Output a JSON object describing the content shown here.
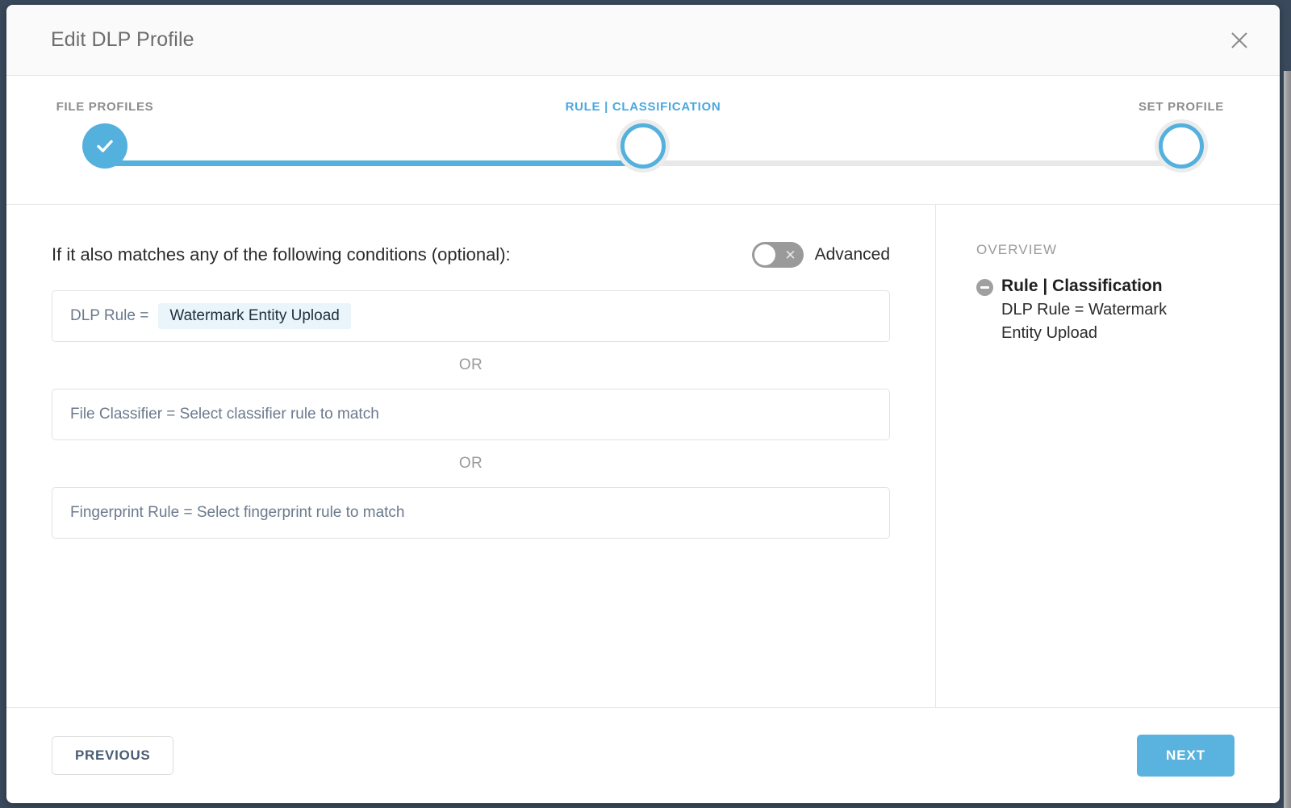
{
  "window": {
    "title": "Edit DLP Profile",
    "close_icon": "close-icon"
  },
  "stepper": {
    "steps": [
      {
        "label": "FILE PROFILES",
        "state": "completed",
        "icon": "check-icon"
      },
      {
        "label": "RULE | CLASSIFICATION",
        "state": "current",
        "icon": "circle-icon"
      },
      {
        "label": "SET PROFILE",
        "state": "upcoming",
        "icon": "circle-icon"
      }
    ],
    "accent_color": "#54b0dd",
    "inactive_color": "#e8e8e8",
    "progress_percent": 50
  },
  "main": {
    "heading": "If it also matches any of the following conditions (optional):",
    "advanced": {
      "label": "Advanced",
      "enabled": false,
      "off_glyph": "✕"
    },
    "or_label": "OR",
    "conditions": [
      {
        "key": "DLP Rule =",
        "value": "Watermark Entity Upload",
        "has_value": true,
        "chip_bg": "#e9f4fb"
      },
      {
        "key": "File Classifier =",
        "placeholder": "Select classifier rule to match",
        "has_value": false,
        "full_text": "File Classifier = Select classifier rule to match"
      },
      {
        "key": "Fingerprint Rule =",
        "placeholder": "Select fingerprint rule to match",
        "has_value": false,
        "full_text": "Fingerprint Rule = Select fingerprint rule to match"
      }
    ]
  },
  "overview": {
    "title": "OVERVIEW",
    "node": {
      "label": "Rule | Classification",
      "collapse_icon": "minus-circle-icon",
      "detail": "DLP Rule = Watermark Entity Upload"
    }
  },
  "footer": {
    "previous_label": "PREVIOUS",
    "next_label": "NEXT",
    "next_color": "#5ab3de"
  }
}
